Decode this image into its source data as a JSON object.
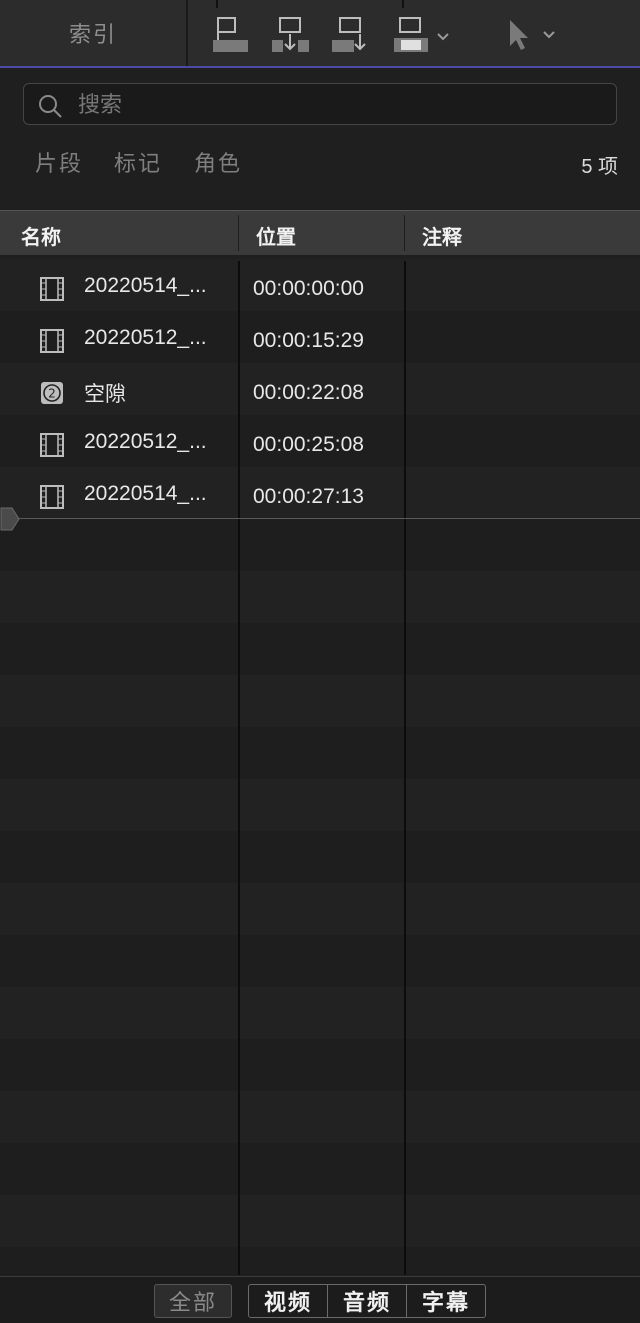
{
  "toolbar": {
    "index_label": "索引",
    "icons": [
      "connect-clip-icon",
      "insert-clip-icon",
      "append-clip-icon",
      "overwrite-clip-icon",
      "select-tool-icon"
    ]
  },
  "search": {
    "placeholder": "搜索",
    "value": ""
  },
  "filter_tabs": {
    "clips": "片段",
    "tags": "标记",
    "roles": "角色"
  },
  "item_count": "5 项",
  "columns": {
    "name": "名称",
    "position": "位置",
    "notes": "注释"
  },
  "rows": [
    {
      "name": "20220514_...",
      "position": "00:00:00:00",
      "icon": "film-icon"
    },
    {
      "name": "20220512_...",
      "position": "00:00:15:29",
      "icon": "film-icon"
    },
    {
      "name": "空隙",
      "position": "00:00:22:08",
      "icon": "gap-icon"
    },
    {
      "name": "20220512_...",
      "position": "00:00:25:08",
      "icon": "film-icon"
    },
    {
      "name": "20220514_...",
      "position": "00:00:27:13",
      "icon": "film-icon"
    }
  ],
  "bottom_filter": {
    "all": "全部",
    "video": "视频",
    "audio": "音频",
    "captions": "字幕"
  }
}
